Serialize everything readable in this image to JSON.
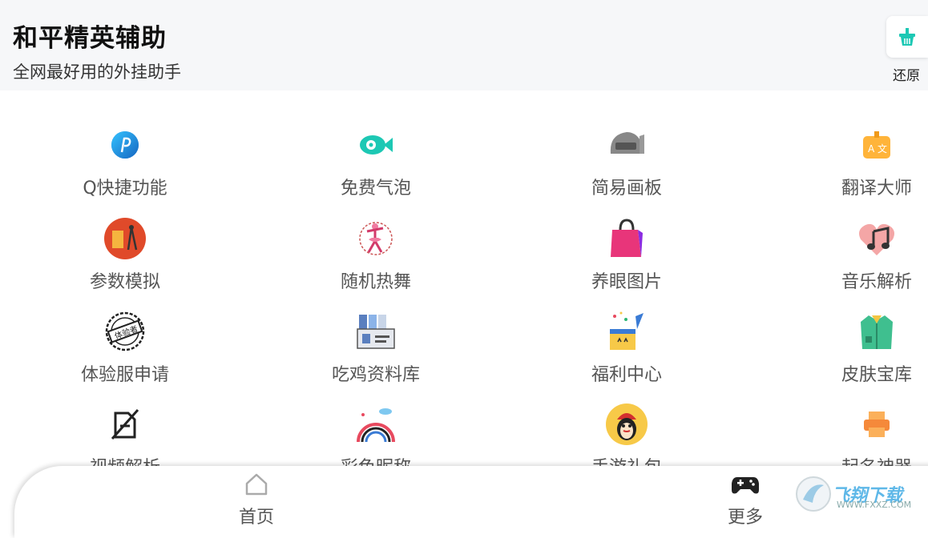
{
  "header": {
    "title": "和平精英辅助",
    "subtitle": "全网最好用的外挂助手",
    "restore_label": "还原",
    "restore_icon": "basket-icon"
  },
  "grid": [
    {
      "label": "Q快捷功能",
      "icon": "q-app-icon"
    },
    {
      "label": "免费气泡",
      "icon": "bubble-fish-icon"
    },
    {
      "label": "简易画板",
      "icon": "helmet-icon"
    },
    {
      "label": "翻译大师",
      "icon": "translate-icon"
    },
    {
      "label": "参数模拟",
      "icon": "ruler-compass-icon"
    },
    {
      "label": "随机热舞",
      "icon": "dancer-icon"
    },
    {
      "label": "养眼图片",
      "icon": "shopping-bag-icon"
    },
    {
      "label": "音乐解析",
      "icon": "music-note-icon"
    },
    {
      "label": "体验服申请",
      "icon": "stamp-icon"
    },
    {
      "label": "吃鸡资料库",
      "icon": "files-icon"
    },
    {
      "label": "福利中心",
      "icon": "gift-box-icon"
    },
    {
      "label": "皮肤宝库",
      "icon": "jacket-icon"
    },
    {
      "label": "视频解析",
      "icon": "video-off-icon"
    },
    {
      "label": "彩色昵称",
      "icon": "rainbow-icon"
    },
    {
      "label": "手游礼包",
      "icon": "penguin-icon"
    },
    {
      "label": "起名神器",
      "icon": "printer-icon"
    }
  ],
  "bottom_nav": {
    "home_label": "首页",
    "more_label": "更多"
  },
  "watermark": {
    "brand": "飞翔下载",
    "url": "WWW.FXXZ.COM"
  },
  "colors": {
    "accent": "#1dc8b4",
    "header_bg": "#f6f7f9",
    "label": "#555555"
  }
}
